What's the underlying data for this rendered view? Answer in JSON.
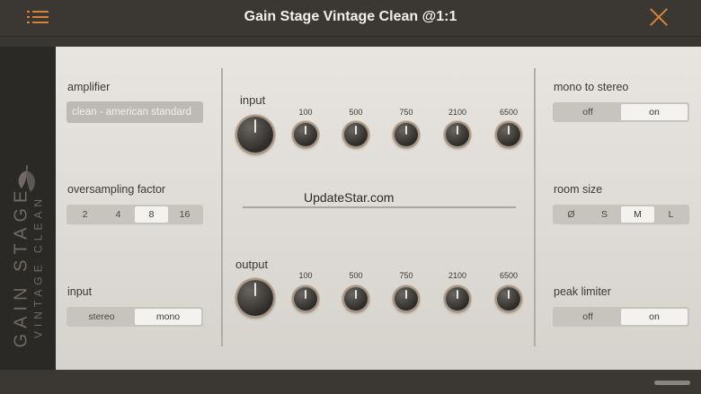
{
  "header": {
    "title": "Gain Stage Vintage Clean @1:1"
  },
  "spine": {
    "line1": "GAIN STAGE",
    "line2": "VINTAGE CLEAN"
  },
  "left": {
    "amplifier_label": "amplifier",
    "amplifier_value": "clean - american standard",
    "oversampling_label": "oversampling factor",
    "oversampling_options": [
      "2",
      "4",
      "8",
      "16"
    ],
    "oversampling_selected": "8",
    "input_label": "input",
    "input_options": [
      "stereo",
      "mono"
    ],
    "input_selected": "mono"
  },
  "center": {
    "input_label": "input",
    "output_label": "output",
    "bands": [
      "100",
      "500",
      "750",
      "2100",
      "6500"
    ],
    "watermark": "UpdateStar.com"
  },
  "right": {
    "mono_label": "mono to stereo",
    "mono_options": [
      "off",
      "on"
    ],
    "mono_selected": "on",
    "room_label": "room size",
    "room_options": [
      "Ø",
      "S",
      "M",
      "L"
    ],
    "room_selected": "M",
    "peak_label": "peak limiter",
    "peak_options": [
      "off",
      "on"
    ],
    "peak_selected": "on"
  },
  "colors": {
    "accent": "#d6833a",
    "background": "#3b3834",
    "panel": "#e3e0db"
  }
}
